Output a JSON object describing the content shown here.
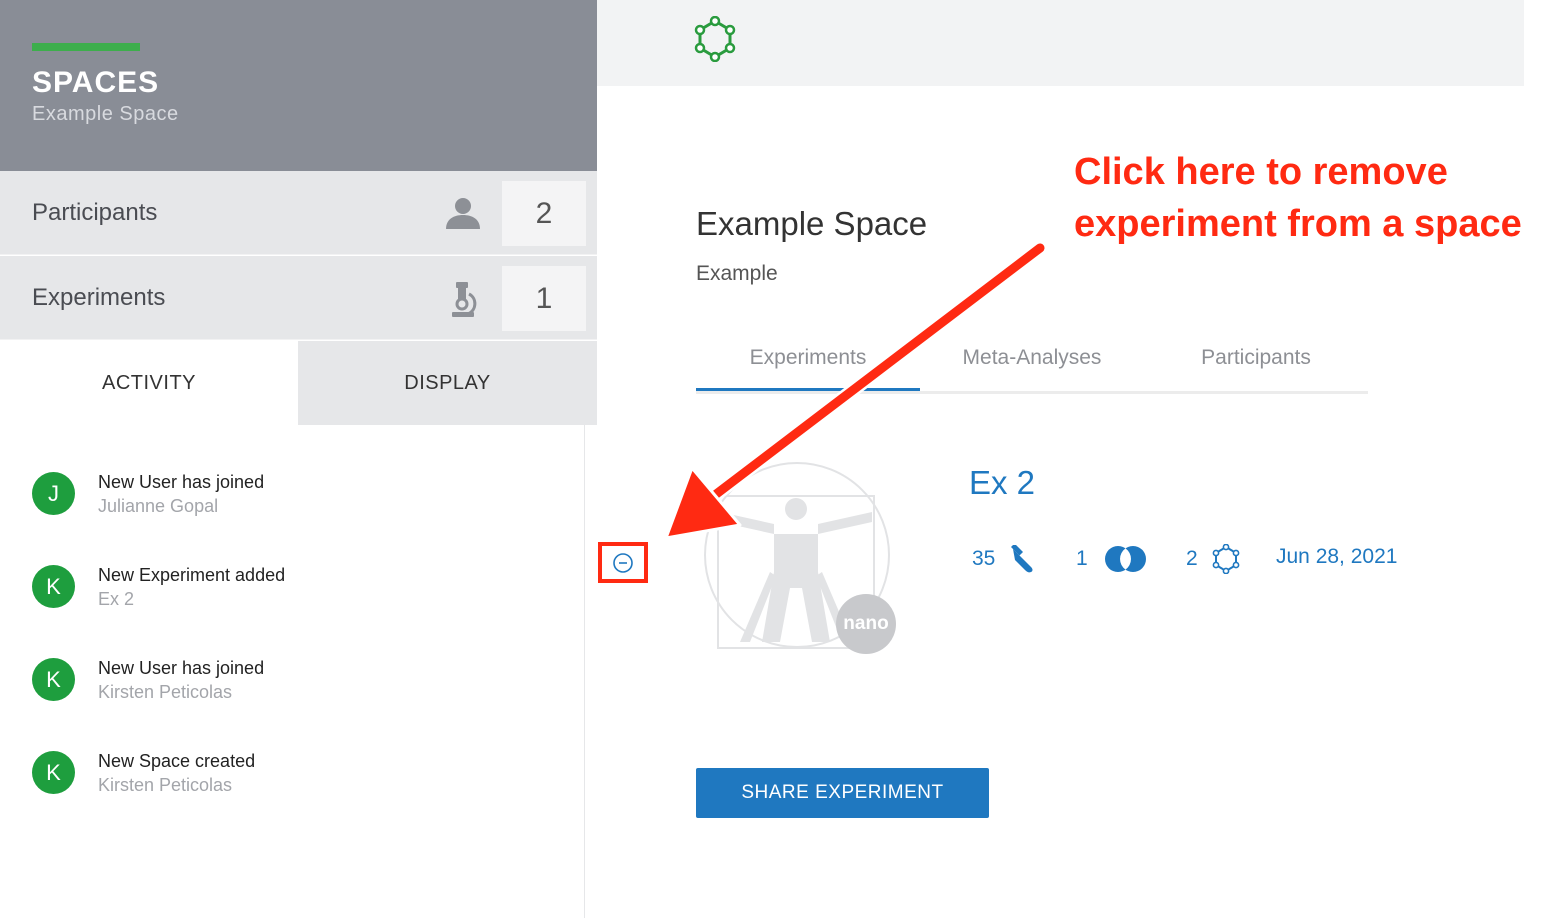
{
  "sidebar": {
    "title": "SPACES",
    "subtitle": "Example Space",
    "accent_color": "#3dae4c",
    "stats": [
      {
        "label": "Participants",
        "icon": "person-icon",
        "count": "2"
      },
      {
        "label": "Experiments",
        "icon": "microscope-icon",
        "count": "1"
      }
    ],
    "tabs": [
      {
        "label": "ACTIVITY",
        "active": true
      },
      {
        "label": "DISPLAY",
        "active": false
      }
    ],
    "activity": [
      {
        "initial": "J",
        "title": "New User has joined",
        "subtitle": "Julianne Gopal"
      },
      {
        "initial": "K",
        "title": "New Experiment added",
        "subtitle": "Ex 2"
      },
      {
        "initial": "K",
        "title": "New User has joined",
        "subtitle": "Kirsten Peticolas"
      },
      {
        "initial": "K",
        "title": "New Space created",
        "subtitle": "Kirsten Peticolas"
      }
    ]
  },
  "header": {
    "logo_icon": "network-hexagon-icon"
  },
  "main": {
    "space_title": "Example Space",
    "space_description": "Example",
    "tabs": [
      {
        "label": "Experiments",
        "active": true
      },
      {
        "label": "Meta-Analyses",
        "active": false
      },
      {
        "label": "Participants",
        "active": false
      }
    ],
    "experiment": {
      "name": "Ex 2",
      "badge": "nano",
      "remove_icon": "minus-circle-icon",
      "samples": "35",
      "comparisons": "1",
      "analyses": "2",
      "date": "Jun 28, 2021"
    },
    "share_button": "SHARE EXPERIMENT"
  },
  "annotation": {
    "text_line1": "Click here to remove",
    "text_line2": "experiment from a space"
  },
  "colors": {
    "primary_blue": "#1f78c0",
    "avatar_green": "#1e9e3e",
    "annotation_red": "#ff2a12",
    "sidebar_header": "#898d96"
  }
}
